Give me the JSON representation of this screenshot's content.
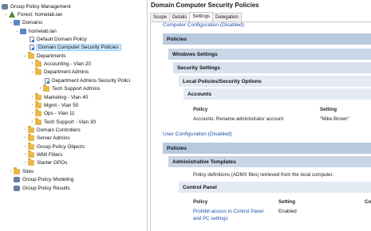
{
  "tree": {
    "root": "Group Policy Management",
    "forest": "Forest: homelab.lan",
    "domains": "Domains",
    "domain": "homelab.lan",
    "default_policy": "Default Domain Policy",
    "selected_policy": "Domain Computer Security Policies",
    "departments": "Departments",
    "accounting": "Accounting - Vlan 20",
    "dept_admins": "Department Admins",
    "dept_admins_policy": "Department Admins Security Polici",
    "tech_support_admins": "Tech Support Admins",
    "marketing": "Marketing - Vlan 40",
    "mgmt": "Mgmt - Vlan 50",
    "ops": "Ops - Vlan 11",
    "tech_support": "Tech Support - Vlan 30",
    "domain_controllers": "Domain Controllers",
    "server_admins": "Server Admins",
    "gpo_objects": "Group Policy Objects",
    "wmi": "WMI Filters",
    "starter": "Starter GPOs",
    "sites": "Sites",
    "modeling": "Group Policy Modeling",
    "results": "Group Policy Results"
  },
  "pane": {
    "title": "Domain Computer Security Policies",
    "tabs": [
      "Scope",
      "Details",
      "Settings",
      "Delegation"
    ],
    "active_tab": "Settings"
  },
  "report": {
    "computer_config": "Computer Configuration (Disabled)",
    "policies": "Policies",
    "windows_settings": "Windows Settings",
    "security_settings": "Security Settings",
    "local_policies": "Local Policies/Security Options",
    "accounts": "Accounts",
    "col_policy": "Policy",
    "col_setting": "Setting",
    "acct_policy": "Accounts: Rename administrator account",
    "acct_setting": "\"Mike Brown\"",
    "user_config": "User Configuration (Disabled)",
    "user_policies": "Policies",
    "admin_templates": "Administrative Templates",
    "admx_note": "Policy definitions (ADMX files) retrieved from the local computer.",
    "control_panel": "Control Panel",
    "cp_col_policy": "Policy",
    "cp_col_setting": "Setting",
    "cp_col_comment": "Co",
    "cp_policy_line1": "Prohibit access to Control Panel",
    "cp_policy_line2": "and PC settings",
    "cp_setting": "Enabled"
  },
  "colors": {
    "selected_bg": "#cce8ff",
    "link": "#1c4fa8",
    "folder": "#e8b84a"
  }
}
